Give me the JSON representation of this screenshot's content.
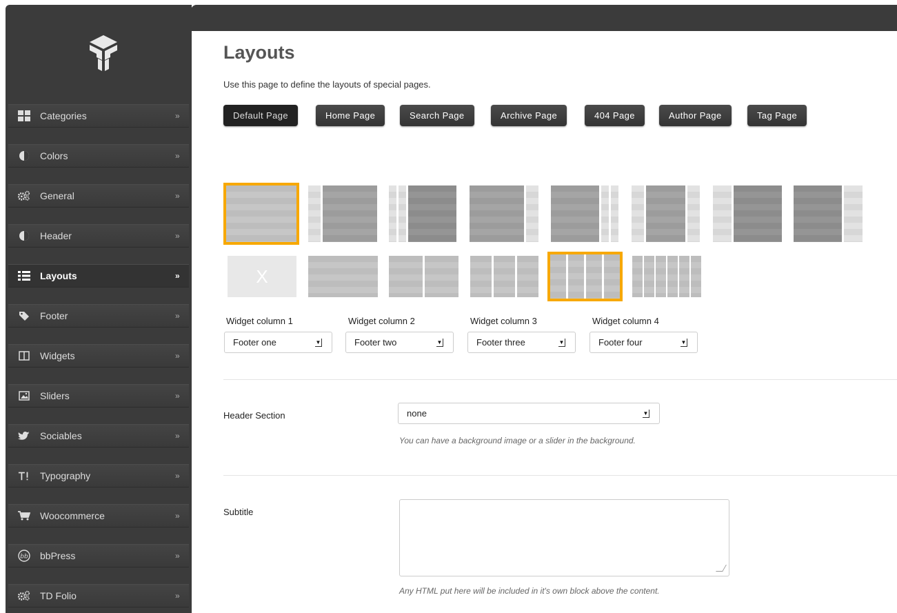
{
  "sidebar": {
    "items": [
      {
        "label": "Categories",
        "icon": "grid-icon"
      },
      {
        "label": "Colors",
        "icon": "contrast-icon"
      },
      {
        "label": "General",
        "icon": "gears-icon"
      },
      {
        "label": "Header",
        "icon": "contrast-icon"
      },
      {
        "label": "Layouts",
        "icon": "list-icon",
        "active": true
      },
      {
        "label": "Footer",
        "icon": "tag-icon"
      },
      {
        "label": "Widgets",
        "icon": "columns-icon"
      },
      {
        "label": "Sliders",
        "icon": "image-icon"
      },
      {
        "label": "Sociables",
        "icon": "bird-icon"
      },
      {
        "label": "Typography",
        "icon": "text-icon"
      },
      {
        "label": "Woocommerce",
        "icon": "cart-icon"
      },
      {
        "label": "bbPress",
        "icon": "bbpress-icon"
      },
      {
        "label": "TD Folio",
        "icon": "gears-icon"
      }
    ],
    "chevron": "»"
  },
  "main": {
    "title": "Layouts",
    "description": "Use this page to define the layouts of special pages.",
    "tabs": [
      {
        "label": "Default Page",
        "selected": true
      },
      {
        "label": "Home Page"
      },
      {
        "label": "Search Page"
      },
      {
        "label": "Archive Page"
      },
      {
        "label": "404 Page"
      },
      {
        "label": "Author Page"
      },
      {
        "label": "Tag Page"
      }
    ],
    "no_footer_mark": "X",
    "widget_columns": [
      {
        "label": "Widget column 1",
        "value": "Footer one"
      },
      {
        "label": "Widget column 2",
        "value": "Footer two"
      },
      {
        "label": "Widget column 3",
        "value": "Footer three"
      },
      {
        "label": "Widget column 4",
        "value": "Footer four"
      }
    ],
    "header_section": {
      "label": "Header Section",
      "value": "none",
      "hint": "You can have a background image or a slider in the background."
    },
    "subtitle": {
      "label": "Subtitle",
      "value": "",
      "hint": "Any HTML put here will be included in it's own block above the content."
    }
  },
  "colors": {
    "accent": "#f7a800",
    "sidebar_bg": "#3b3b3b"
  }
}
